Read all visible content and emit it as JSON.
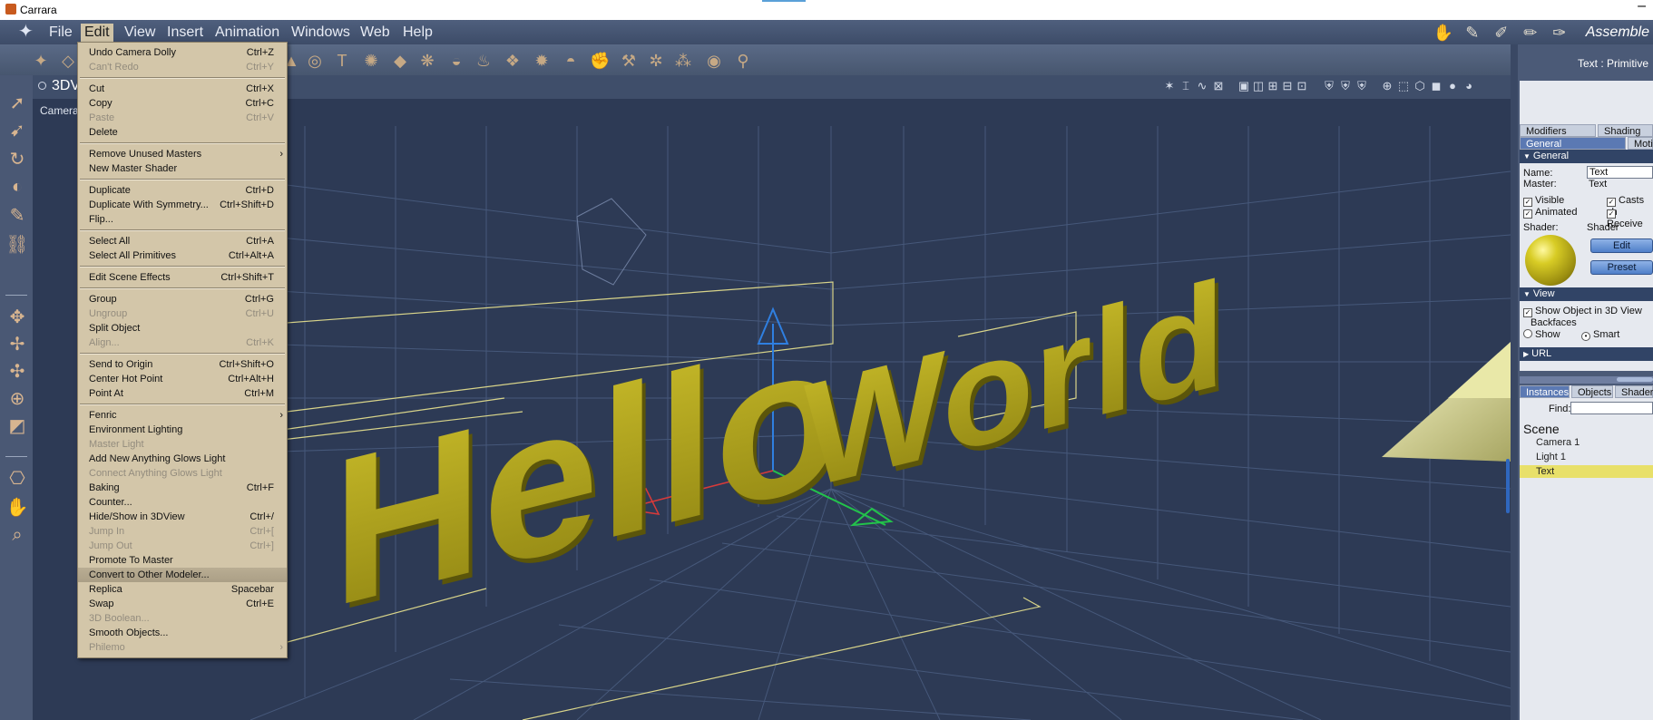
{
  "window": {
    "title": "Carrara"
  },
  "menubar": {
    "items": [
      "File",
      "Edit",
      "View",
      "Insert",
      "Animation",
      "Windows",
      "Web",
      "Help"
    ],
    "active": "Edit",
    "room_label": "Assemble"
  },
  "viewport": {
    "tab": "3DV",
    "camera_label": "Camera"
  },
  "scene_text": {
    "word1": "Hello",
    "word2": "World"
  },
  "edit_menu": [
    {
      "label": "Undo Camera Dolly",
      "shortcut": "Ctrl+Z",
      "enabled": true
    },
    {
      "label": "Can't Redo",
      "shortcut": "Ctrl+Y",
      "enabled": false
    },
    {
      "sep": true
    },
    {
      "label": "Cut",
      "shortcut": "Ctrl+X",
      "enabled": true
    },
    {
      "label": "Copy",
      "shortcut": "Ctrl+C",
      "enabled": true
    },
    {
      "label": "Paste",
      "shortcut": "Ctrl+V",
      "enabled": false
    },
    {
      "label": "Delete",
      "shortcut": "",
      "enabled": true
    },
    {
      "sep": true
    },
    {
      "label": "Remove Unused Masters",
      "shortcut": "",
      "enabled": true,
      "submenu": true
    },
    {
      "label": "New Master Shader",
      "shortcut": "",
      "enabled": true
    },
    {
      "sep": true
    },
    {
      "label": "Duplicate",
      "shortcut": "Ctrl+D",
      "enabled": true
    },
    {
      "label": "Duplicate With Symmetry...",
      "shortcut": "Ctrl+Shift+D",
      "enabled": true
    },
    {
      "label": "Flip...",
      "shortcut": "",
      "enabled": true
    },
    {
      "sep": true
    },
    {
      "label": "Select All",
      "shortcut": "Ctrl+A",
      "enabled": true
    },
    {
      "label": "Select All Primitives",
      "shortcut": "Ctrl+Alt+A",
      "enabled": true
    },
    {
      "sep": true
    },
    {
      "label": "Edit Scene Effects",
      "shortcut": "Ctrl+Shift+T",
      "enabled": true
    },
    {
      "sep": true
    },
    {
      "label": "Group",
      "shortcut": "Ctrl+G",
      "enabled": true
    },
    {
      "label": "Ungroup",
      "shortcut": "Ctrl+U",
      "enabled": false
    },
    {
      "label": "Split Object",
      "shortcut": "",
      "enabled": true
    },
    {
      "label": "Align...",
      "shortcut": "Ctrl+K",
      "enabled": false
    },
    {
      "sep": true
    },
    {
      "label": "Send to Origin",
      "shortcut": "Ctrl+Shift+O",
      "enabled": true
    },
    {
      "label": "Center Hot Point",
      "shortcut": "Ctrl+Alt+H",
      "enabled": true
    },
    {
      "label": "Point At",
      "shortcut": "Ctrl+M",
      "enabled": true
    },
    {
      "sep": true
    },
    {
      "label": "Fenric",
      "shortcut": "",
      "enabled": true,
      "submenu": true
    },
    {
      "label": "Environment Lighting",
      "shortcut": "",
      "enabled": true
    },
    {
      "label": "Master Light",
      "shortcut": "",
      "enabled": false
    },
    {
      "label": "Add New Anything Glows Light",
      "shortcut": "",
      "enabled": true
    },
    {
      "label": "Connect Anything Glows Light",
      "shortcut": "",
      "enabled": false
    },
    {
      "label": "Baking",
      "shortcut": "Ctrl+F",
      "enabled": true
    },
    {
      "label": "Counter...",
      "shortcut": "",
      "enabled": true
    },
    {
      "label": "Hide/Show in 3DView",
      "shortcut": "Ctrl+/",
      "enabled": true
    },
    {
      "label": "Jump In",
      "shortcut": "Ctrl+[",
      "enabled": false
    },
    {
      "label": "Jump Out",
      "shortcut": "Ctrl+]",
      "enabled": false
    },
    {
      "label": "Promote To Master",
      "shortcut": "",
      "enabled": true
    },
    {
      "label": "Convert to Other Modeler...",
      "shortcut": "",
      "enabled": true,
      "highlighted": true
    },
    {
      "label": "Replica",
      "shortcut": "Spacebar",
      "enabled": true
    },
    {
      "label": "Swap",
      "shortcut": "Ctrl+E",
      "enabled": true
    },
    {
      "label": "3D Boolean...",
      "shortcut": "",
      "enabled": false
    },
    {
      "label": "Smooth Objects...",
      "shortcut": "",
      "enabled": true
    },
    {
      "label": "Philemo",
      "shortcut": "",
      "enabled": false,
      "submenu": true
    }
  ],
  "right_panel": {
    "title": "Text : Primitive",
    "tabs_top": [
      "Modifiers",
      "Shading"
    ],
    "tabs_second": [
      "General",
      "Moti"
    ],
    "general_header": "General",
    "name_label": "Name:",
    "name_value": "Text",
    "master_label": "Master:",
    "master_value": "Text",
    "visible": "Visible",
    "casts": "Casts sh",
    "animated": "Animated",
    "receive": "Receive",
    "shader_label": "Shader:",
    "shader_value": "Shader",
    "edit_btn": "Edit",
    "preset_btn": "Preset",
    "view_header": "View",
    "show_object": "Show Object in 3D View",
    "backfaces": "Backfaces",
    "show": "Show",
    "smart": "Smart",
    "url_header": "URL",
    "bottom_tabs": [
      "Instances",
      "Objects",
      "Shaders"
    ],
    "find_label": "Find:",
    "scene_label": "Scene",
    "scene_items": [
      "Camera 1",
      "Light 1",
      "Text"
    ],
    "selected_item": "Text"
  },
  "colors": {
    "accent": "#5b79b3",
    "menu_bg": "#d3c6a9",
    "viewport_bg": "#2d3a55",
    "text_yellow": "#b8ab1c"
  }
}
